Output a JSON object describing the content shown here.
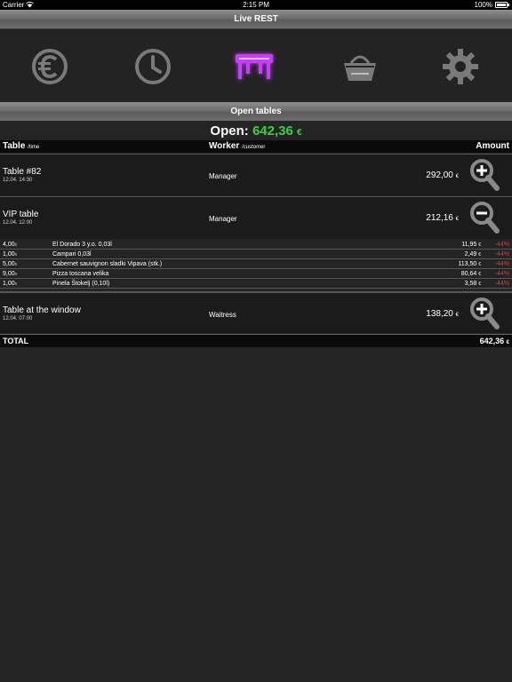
{
  "status_bar": {
    "carrier": "Carrier",
    "time": "2:15 PM",
    "battery": "100%"
  },
  "app_title": "Live REST",
  "toolbar": {
    "icons": [
      "euro-icon",
      "clock-icon",
      "table-icon",
      "basket-icon",
      "gear-icon"
    ],
    "active_icon": "table-icon",
    "active_color": "#c63cff",
    "inactive_color": "#7a7a7a"
  },
  "section_title": "Open tables",
  "open_summary": {
    "label": "Open:",
    "value": "642,36",
    "currency": "€",
    "value_color": "#35d43a"
  },
  "columns": {
    "table": "Table",
    "table_sub": "/time",
    "worker": "Worker",
    "worker_sub": "/customer",
    "amount": "Amount"
  },
  "tables": [
    {
      "name": "Table #82",
      "time": "12.04. 14:30",
      "worker": "Manager",
      "amount": "292,00",
      "currency": "€",
      "expanded": false
    },
    {
      "name": "VIP table",
      "time": "12.04. 12:00",
      "worker": "Manager",
      "amount": "212,16",
      "currency": "€",
      "expanded": true
    },
    {
      "name": "Table at the window",
      "time": "12.04. 07:00",
      "worker": "Waitress",
      "amount": "138,20",
      "currency": "€",
      "expanded": false
    }
  ],
  "vip_items": [
    {
      "qty": "4,00",
      "qty_unit": "x",
      "name": "El Dorado 3 y.o. 0,03l",
      "price": "11,95",
      "currency": "€",
      "discount": "-44%"
    },
    {
      "qty": "1,00",
      "qty_unit": "x",
      "name": "Campari 0,03l",
      "price": "2,49",
      "currency": "€",
      "discount": "-44%"
    },
    {
      "qty": "5,00",
      "qty_unit": "x",
      "name": "Cabernet sauvignon sladki Vipava (stk.)",
      "price": "113,50",
      "currency": "€",
      "discount": "-44%"
    },
    {
      "qty": "9,00",
      "qty_unit": "x",
      "name": "Pizza toscana velika",
      "price": "80,64",
      "currency": "€",
      "discount": "-44%"
    },
    {
      "qty": "1,00",
      "qty_unit": "x",
      "name": "Pinela Štokelj (0,10l)",
      "price": "3,58",
      "currency": "€",
      "discount": "-44%"
    }
  ],
  "total": {
    "label": "TOTAL",
    "value": "642,36",
    "currency": "€"
  }
}
